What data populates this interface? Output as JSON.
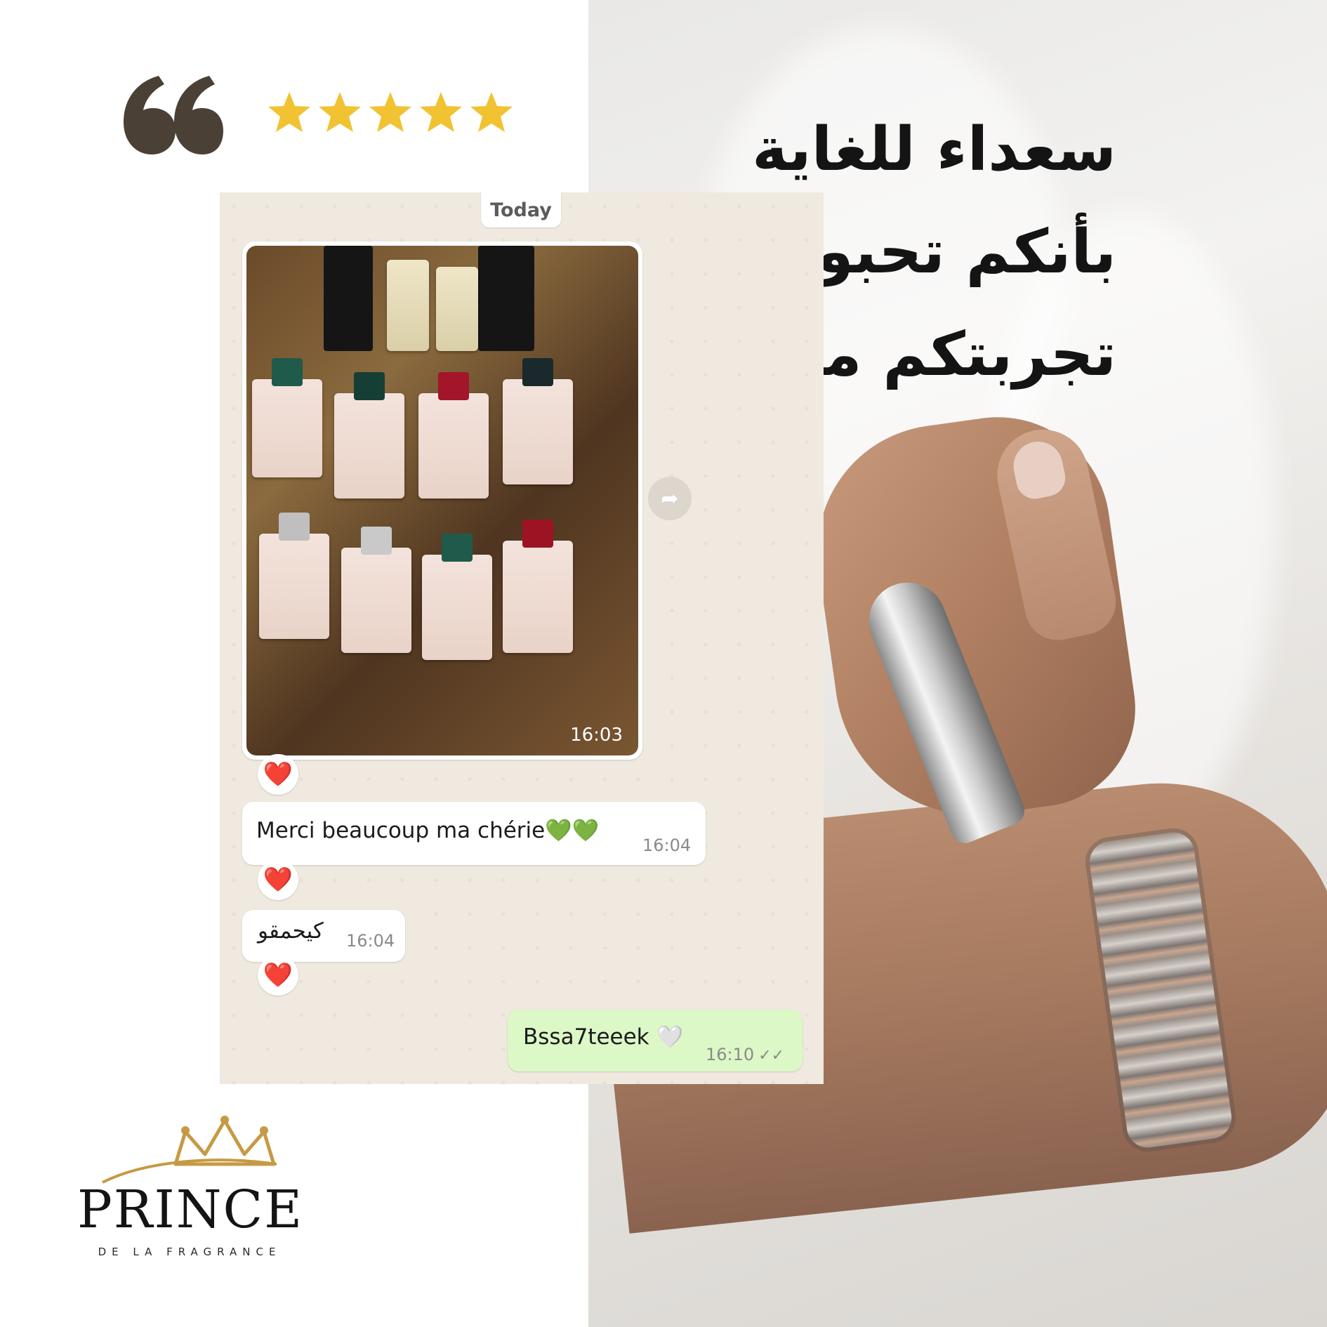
{
  "headline": {
    "line1": "سعداء للغاية",
    "line2": "بأنكم تحبون",
    "line3": "تجربتكم معنا"
  },
  "rating": {
    "stars": 5,
    "max": 5
  },
  "colors": {
    "star": "#f1c232",
    "quote": "#4a4036",
    "outgoing_bubble": "#dcf8c6",
    "heart": "#e0182d"
  },
  "chat": {
    "date_chip": "Today",
    "image_message": {
      "time": "16:03",
      "reaction": "❤️"
    },
    "messages": [
      {
        "text": "Merci beaucoup ma chérie💚💚",
        "time": "16:04",
        "reaction": "❤️",
        "direction": "incoming"
      },
      {
        "text": "كيحمقو",
        "time": "16:04",
        "reaction": "❤️",
        "direction": "incoming"
      },
      {
        "text": "Bssa7teeek 🤍",
        "time": "16:10",
        "ticks": "✓✓",
        "direction": "outgoing"
      }
    ],
    "forward_icon": "forward-arrow-icon"
  },
  "logo": {
    "word": "PRINCE",
    "sub": "DE LA FRAGRANCE"
  }
}
